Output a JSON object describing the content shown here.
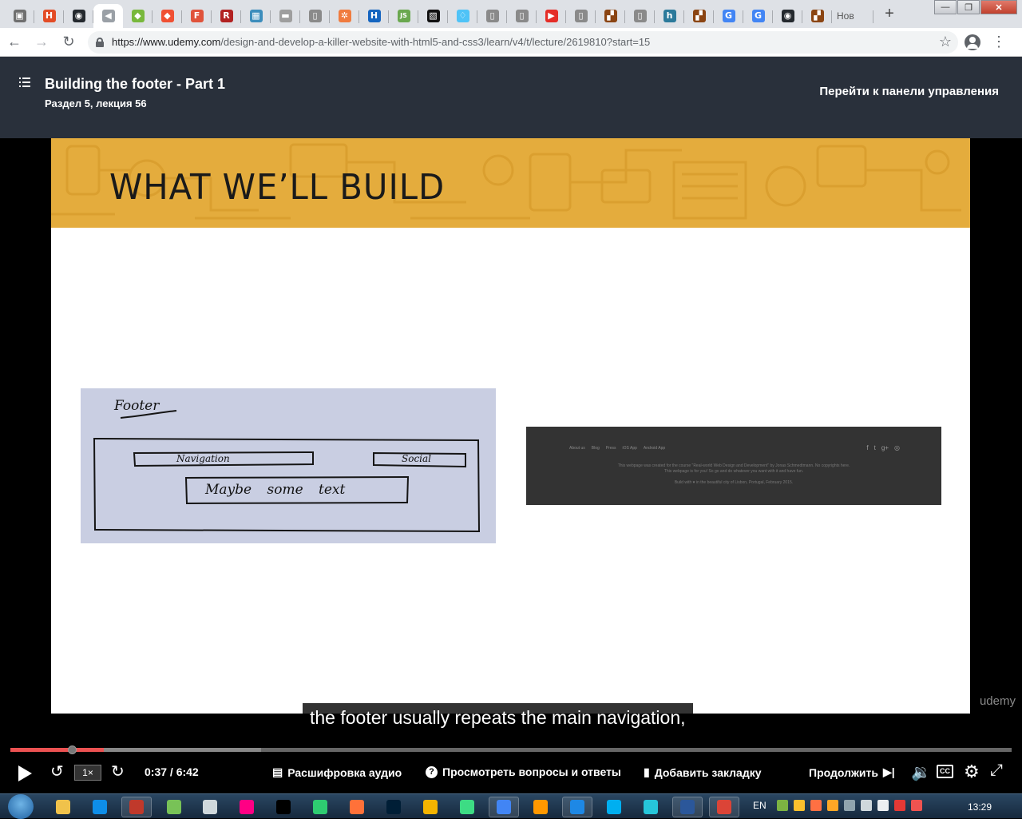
{
  "browser": {
    "tabs": [
      {
        "name": "tab-1",
        "color": "#6f6f6f",
        "glyph": "▣"
      },
      {
        "name": "tab-2",
        "color": "#e34c26",
        "glyph": "H"
      },
      {
        "name": "tab-3",
        "color": "#24292e",
        "glyph": "◉"
      },
      {
        "name": "tab-4-active",
        "color": "#9aa0a6",
        "glyph": "◀"
      },
      {
        "name": "tab-5",
        "color": "#78b83c",
        "glyph": "◆"
      },
      {
        "name": "tab-6",
        "color": "#f05033",
        "glyph": "◆"
      },
      {
        "name": "tab-7",
        "color": "#e0533b",
        "glyph": "F"
      },
      {
        "name": "tab-8",
        "color": "#b22222",
        "glyph": "R"
      },
      {
        "name": "tab-9",
        "color": "#3c8dbc",
        "glyph": "▦"
      },
      {
        "name": "tab-10",
        "color": "#9e9e9e",
        "glyph": "▬"
      },
      {
        "name": "tab-11",
        "color": "#8a8a8a",
        "glyph": "▯"
      },
      {
        "name": "tab-12",
        "color": "#f07b3f",
        "glyph": "✲"
      },
      {
        "name": "tab-13",
        "color": "#1565c0",
        "glyph": "H"
      },
      {
        "name": "tab-14",
        "color": "#6aa84f",
        "glyph": "JS"
      },
      {
        "name": "tab-15",
        "color": "#111111",
        "glyph": "▧"
      },
      {
        "name": "tab-16",
        "color": "#4fc3f7",
        "glyph": "♢"
      },
      {
        "name": "tab-17",
        "color": "#8a8a8a",
        "glyph": "▯"
      },
      {
        "name": "tab-18",
        "color": "#8a8a8a",
        "glyph": "▯"
      },
      {
        "name": "tab-19",
        "color": "#e52d27",
        "glyph": "▶"
      },
      {
        "name": "tab-20",
        "color": "#8a8a8a",
        "glyph": "▯"
      },
      {
        "name": "tab-21",
        "color": "#8b4513",
        "glyph": "▞"
      },
      {
        "name": "tab-22",
        "color": "#8a8a8a",
        "glyph": "▯"
      },
      {
        "name": "tab-23",
        "color": "#2c7a9b",
        "glyph": "h"
      },
      {
        "name": "tab-24",
        "color": "#8b4513",
        "glyph": "▞"
      },
      {
        "name": "tab-25",
        "color": "#4285f4",
        "glyph": "G"
      },
      {
        "name": "tab-26",
        "color": "#4285f4",
        "glyph": "G"
      },
      {
        "name": "tab-27",
        "color": "#24292e",
        "glyph": "◉"
      },
      {
        "name": "tab-28",
        "color": "#8b4513",
        "glyph": "▞"
      }
    ],
    "last_tab_label": "Нов",
    "new_tab": "+",
    "window_controls": {
      "minimize": "—",
      "maximize": "❐",
      "close": "✕"
    },
    "url_host": "https://www.udemy.com",
    "url_path": "/design-and-develop-a-killer-website-with-html5-and-css3/learn/v4/t/lecture/2619810?start=15",
    "back": "←",
    "forward": "→",
    "reload": "↻",
    "star": "☆",
    "menu": "⋮"
  },
  "header": {
    "title": "Building the footer - Part 1",
    "subtitle": "Раздел 5, лекция 56",
    "dashboard_link": "Перейти к панели управления"
  },
  "slide": {
    "heading": "WHAT WE’LL BUILD",
    "sketch": {
      "footer_label": "Footer",
      "navigation_label": "Navigation",
      "social_label": "Social",
      "text_label": "Maybe some text"
    },
    "footer_screenshot": {
      "nav": [
        "About us",
        "Blog",
        "Press",
        "iOS App",
        "Android App"
      ],
      "social": [
        "f",
        "t",
        "g+",
        "◎"
      ],
      "copyright_1": "This webpage was created for the course \"Real-world Web Design and Development\" by Jonas Schmedtmann. No copyrights here.",
      "copyright_2": "This webpage is for you! So go and do whatever you want with it and have fun.",
      "build_with": "Build with ♥ in the beautiful city of Lisbon, Portugal, February 2015."
    },
    "watermark": "udemy"
  },
  "caption": "the footer usually repeats the main navigation,",
  "player": {
    "progress_played": 0.093,
    "progress_buffered": 0.25,
    "speed": "1×",
    "time": "0:37 / 6:42",
    "transcript": "Расшифровка аудио",
    "qa": "Просмотреть вопросы и ответы",
    "bookmark": "Добавить закладку",
    "continue": "Продолжить",
    "cc": "CC"
  },
  "taskbar": {
    "apps": [
      {
        "name": "explorer-icon",
        "color": "#f0c24b"
      },
      {
        "name": "teamviewer-icon",
        "color": "#0e8ee9"
      },
      {
        "name": "floppy-icon",
        "color": "#c0392b",
        "pinned": true
      },
      {
        "name": "android-icon",
        "color": "#78c257"
      },
      {
        "name": "cube-icon",
        "color": "#cfd8dc"
      },
      {
        "name": "flickr-icon",
        "color": "#ff0084"
      },
      {
        "name": "intellij-icon",
        "color": "#000000"
      },
      {
        "name": "app-green-icon",
        "color": "#2ecc71"
      },
      {
        "name": "firefox-icon",
        "color": "#ff7139"
      },
      {
        "name": "photoshop-icon",
        "color": "#001e36"
      },
      {
        "name": "chrome-canary-icon",
        "color": "#f4b400"
      },
      {
        "name": "android-studio-icon",
        "color": "#3ddc84"
      },
      {
        "name": "chrome-icon",
        "color": "#4285f4",
        "pinned": true
      },
      {
        "name": "sublime-icon",
        "color": "#ff9800"
      },
      {
        "name": "app-blue-icon",
        "color": "#1e88e5",
        "pinned": true
      },
      {
        "name": "skype-icon",
        "color": "#00aff0"
      },
      {
        "name": "calculator-icon",
        "color": "#26c6da"
      },
      {
        "name": "word-icon",
        "color": "#2b579a",
        "pinned": true
      },
      {
        "name": "chrome-2-icon",
        "color": "#db4437",
        "pinned": true
      }
    ],
    "language": "EN",
    "clock": "13:29"
  }
}
